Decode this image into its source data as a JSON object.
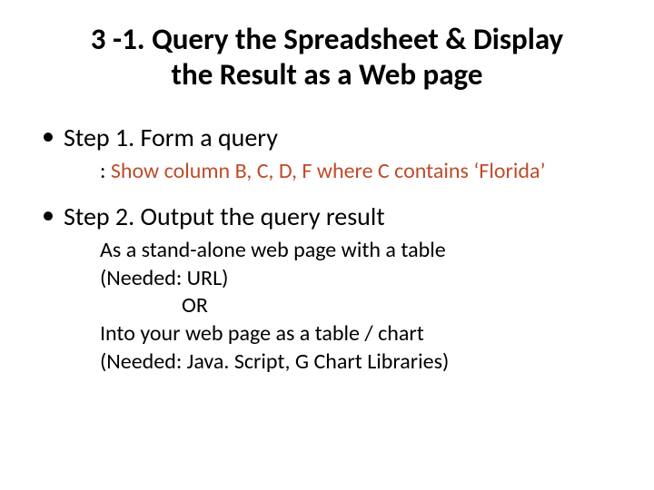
{
  "title": "3 -1. Query the Spreadsheet & Display the Result as a Web page",
  "step1": {
    "head": "Step 1. Form a query",
    "colon": ": ",
    "detail": "Show column B, C, D, F where C contains ‘Florida’"
  },
  "step2": {
    "head": "Step 2. Output the query result",
    "line1": "As a stand-alone web page with a table",
    "line2": "(Needed: URL)",
    "or": "OR",
    "line3": "Into your web page as a table / chart",
    "line4": "(Needed: Java. Script, G Chart Libraries)"
  }
}
